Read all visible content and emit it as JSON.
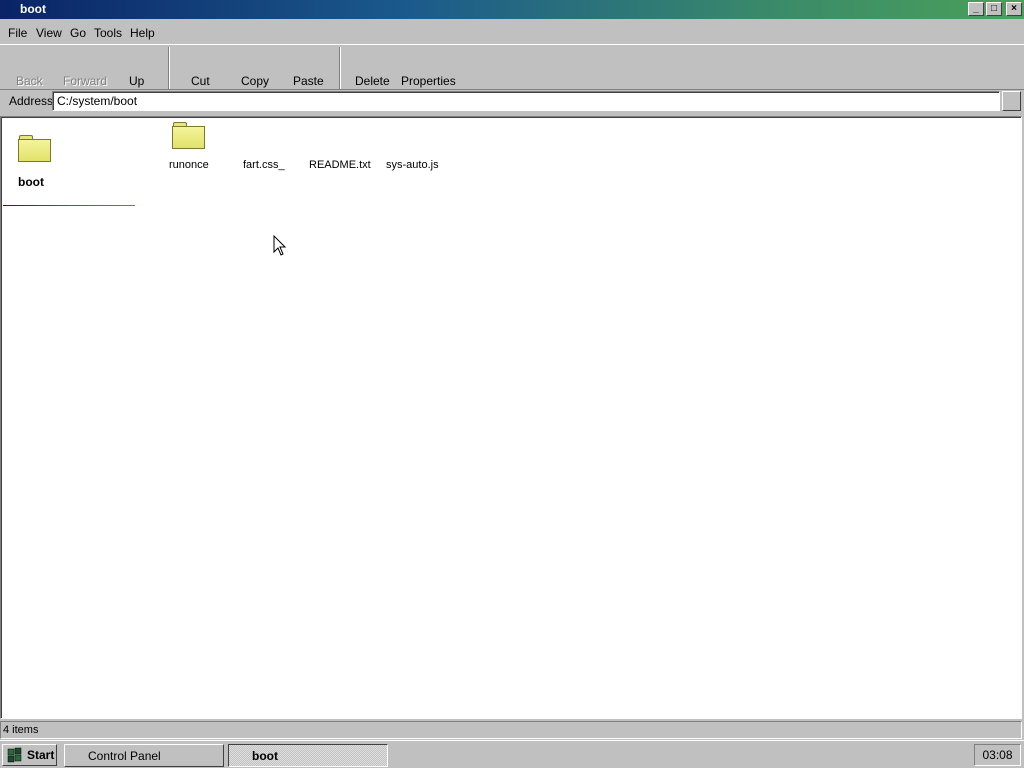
{
  "window": {
    "title": "boot",
    "minimize_label": "_",
    "maximize_label": "□",
    "close_label": "×"
  },
  "menu": [
    "File",
    "View",
    "Go",
    "Tools",
    "Help"
  ],
  "toolbar": {
    "back": "Back",
    "forward": "Forward",
    "up": "Up",
    "cut": "Cut",
    "copy": "Copy",
    "paste": "Paste",
    "delete": "Delete",
    "properties": "Properties"
  },
  "address": {
    "label": "Address",
    "value": "C:/system/boot"
  },
  "sidebar": {
    "title": "boot",
    "icon": "folder-icon"
  },
  "files": [
    {
      "name": "runonce",
      "type": "folder",
      "icon": "folder-icon"
    },
    {
      "name": "fart.css_",
      "type": "file"
    },
    {
      "name": "README.txt",
      "type": "file"
    },
    {
      "name": "sys-auto.js",
      "type": "file"
    }
  ],
  "status": {
    "text": "4 items"
  },
  "taskbar": {
    "start_label": "Start",
    "tasks": [
      {
        "label": "Control Panel",
        "active": false
      },
      {
        "label": "boot",
        "active": true
      }
    ],
    "clock": "03:08"
  },
  "colors": {
    "title_gradient_start": "#0a2466",
    "title_gradient_end": "#4aa05a",
    "folder": "#e8e87a",
    "window_bg": "#c0c0c0"
  }
}
